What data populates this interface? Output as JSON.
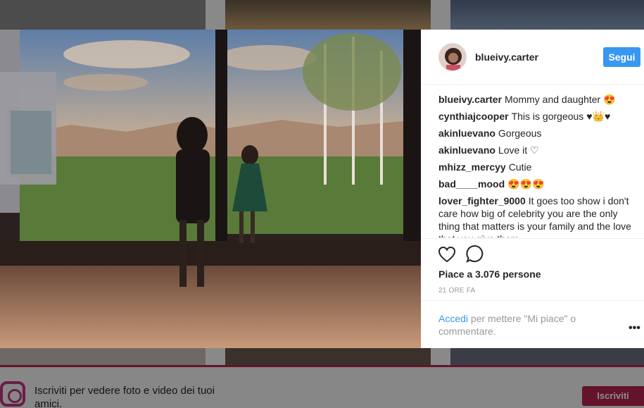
{
  "post": {
    "username": "blueivy.carter",
    "follow_label": "Segui",
    "comments": [
      {
        "user": "blueivy.carter",
        "text": "Mommy and daughter 😍"
      },
      {
        "user": "cynthiajcooper",
        "text": "This is gorgeous ♥👑♥"
      },
      {
        "user": "akinluevano",
        "text": "Gorgeous"
      },
      {
        "user": "akinluevano",
        "text": "Love it ♡"
      },
      {
        "user": "mhizz_mercyy",
        "text": "Cutie"
      },
      {
        "user": "bad____mood",
        "text": "😍😍😍"
      },
      {
        "user": "lover_fighter_9000",
        "text": "It goes too show i don't care how big of celebrity you are the only thing that matters is your family and the love that you give them"
      }
    ],
    "likes": "Piace a 3.076 persone",
    "time": "21 ORE FA",
    "login_link": "Accedi",
    "login_rest": " per mettere \"Mi piace\" o commentare.",
    "more_icon": "more-dots-icon"
  },
  "signup": {
    "text": "Iscriviti per vedere foto e video dei tuoi amici.",
    "button": "Iscriviti"
  },
  "colors": {
    "follow": "#3897f0",
    "signup_bar": "#b5264f",
    "link": "#3897f0"
  }
}
